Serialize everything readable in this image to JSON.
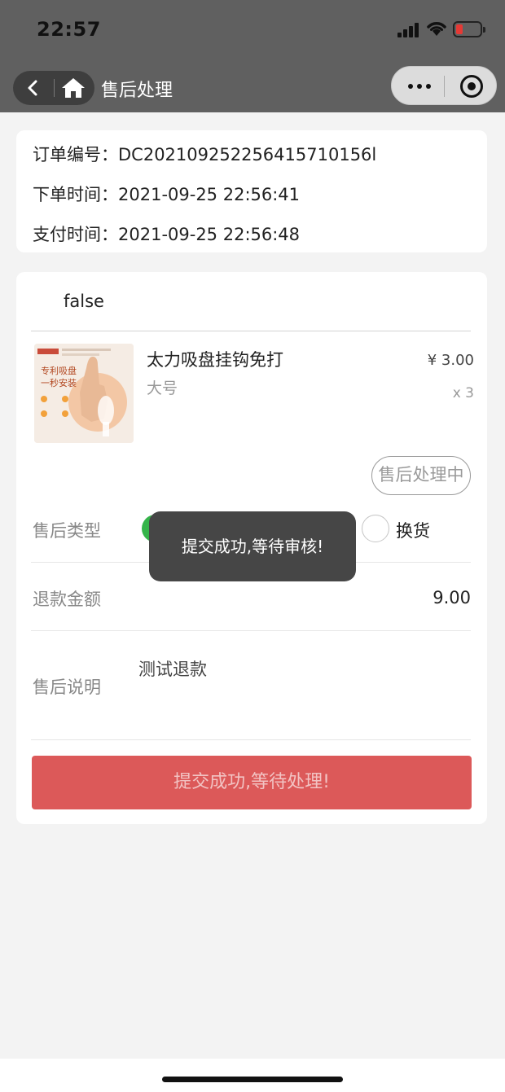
{
  "status_bar": {
    "time": "22:57",
    "icons": [
      "signal-icon",
      "wifi-icon",
      "battery-icon"
    ],
    "battery_color": "#e53935"
  },
  "nav": {
    "title": "售后处理",
    "back_icon": "back-arrow-icon",
    "home_icon": "home-icon",
    "menu_icon": "more-dots-icon",
    "close_icon": "target-icon"
  },
  "order_info": {
    "order_no": "订单编号：DC202109252256415710156l",
    "order_time": "下单时间：2021-09-25 22:56:41",
    "pay_time": "支付时间：2021-09-25 22:56:48"
  },
  "shop": {
    "name": "false"
  },
  "product": {
    "name": "太力吸盘挂钩免打",
    "spec": "大号",
    "price": "¥ 3.00",
    "qty": "x 3",
    "image_text": [
      "专利吸盘",
      "一秒安装"
    ]
  },
  "after_sale": {
    "status": "售后处理中",
    "type_label": "售后类型",
    "type_option_exchange": "换货",
    "refund_label": "退款金额",
    "refund_amount": "9.00",
    "remark_label": "售后说明",
    "remark_value": "测试退款",
    "submit_label": "提交成功,等待处理!"
  },
  "toast": {
    "message": "提交成功,等待审核!"
  },
  "colors": {
    "header_bg": "#606060",
    "accent_green": "#35b44a",
    "submit_bg": "#dc5959",
    "toast_bg": "#464646"
  }
}
